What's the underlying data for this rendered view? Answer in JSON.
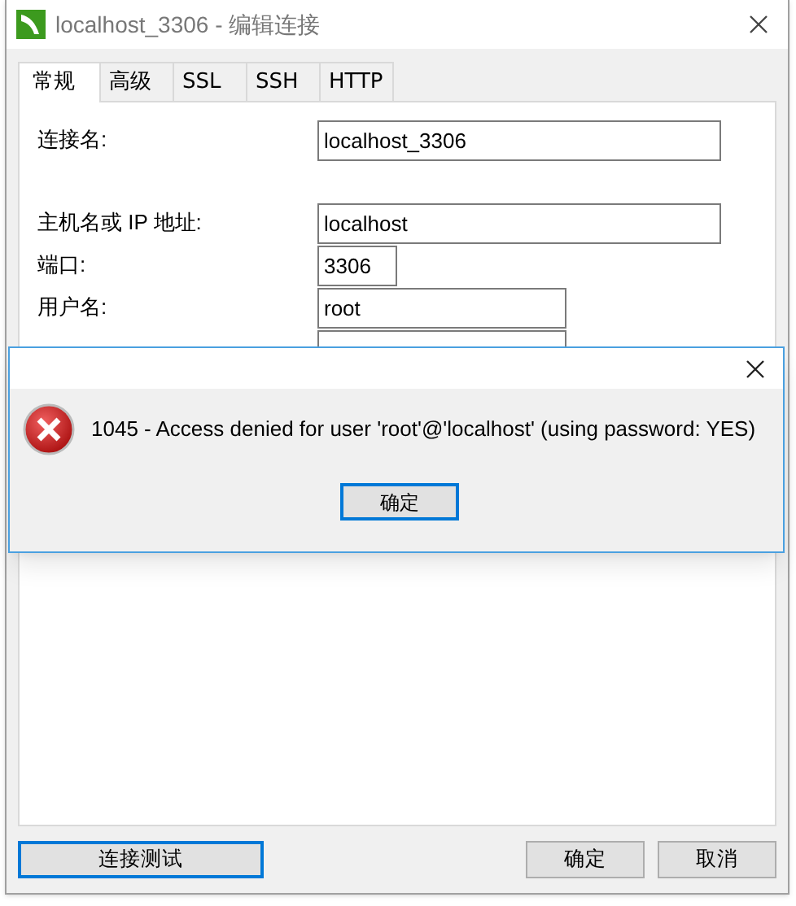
{
  "window": {
    "title": "localhost_3306 - 编辑连接"
  },
  "tabs": [
    {
      "label": "常规",
      "selected": true
    },
    {
      "label": "高级",
      "selected": false
    },
    {
      "label": "SSL",
      "selected": false
    },
    {
      "label": "SSH",
      "selected": false
    },
    {
      "label": "HTTP",
      "selected": false
    }
  ],
  "form": [
    {
      "label": "连接名:",
      "value": "localhost_3306"
    },
    {
      "label": "主机名或 IP 地址:",
      "value": "localhost"
    },
    {
      "label": "端口:",
      "value": "3306"
    },
    {
      "label": "用户名:",
      "value": "root"
    }
  ],
  "error_dialog": {
    "message": "1045 - Access denied for user 'root'@'localhost' (using password: YES)",
    "button": "确定"
  },
  "buttons": [
    {
      "label": "连接测试",
      "focused": true
    },
    {
      "label": "确定",
      "focused": false
    },
    {
      "label": "取消",
      "focused": false
    }
  ]
}
